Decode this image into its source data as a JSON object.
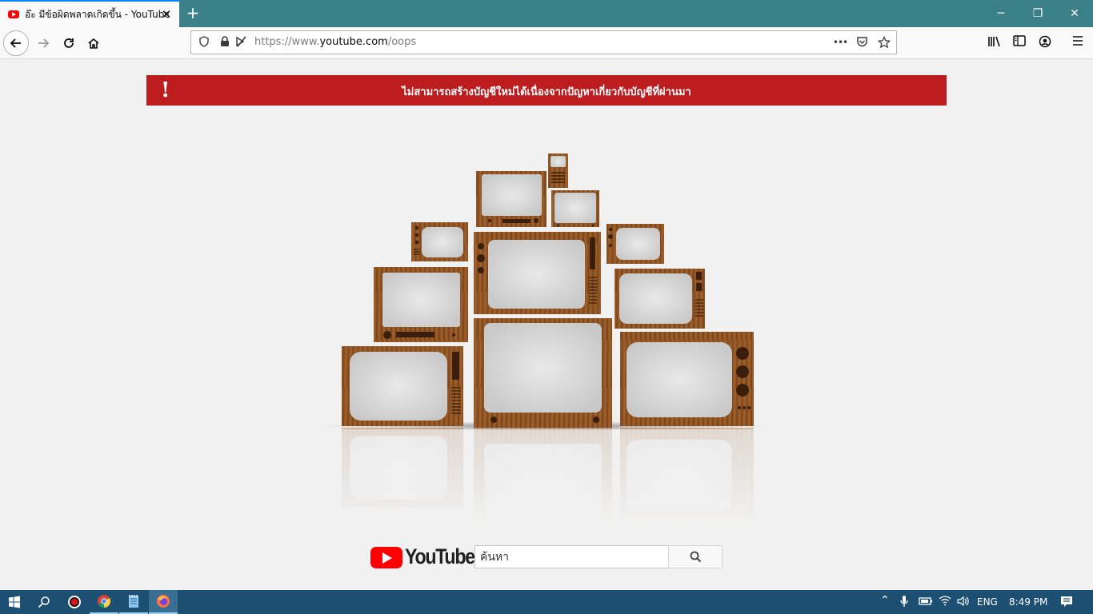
{
  "browser": {
    "tab_title": "อ๊ะ มีข้อผิดพลาดเกิดขึ้น - YouTube",
    "url_prefix": "https://www.",
    "url_host": "youtube.com",
    "url_path": "/oops",
    "url_menu": "•••"
  },
  "banner": {
    "icon": "!",
    "message": "ไม่สามารถสร้างบัญชีใหม่ได้เนื่องจากปัญหาเกี่ยวกับบัญชีที่ผ่านมา"
  },
  "footer": {
    "logo_text": "YouTube",
    "search_placeholder": "ค้นหา"
  },
  "taskbar": {
    "language": "ENG",
    "time": "8:49 PM"
  },
  "colors": {
    "banner": "#bd1d1f",
    "youtube_red": "#ff0000",
    "taskbar": "#1d4f73",
    "tabbar": "#3b7f89"
  }
}
